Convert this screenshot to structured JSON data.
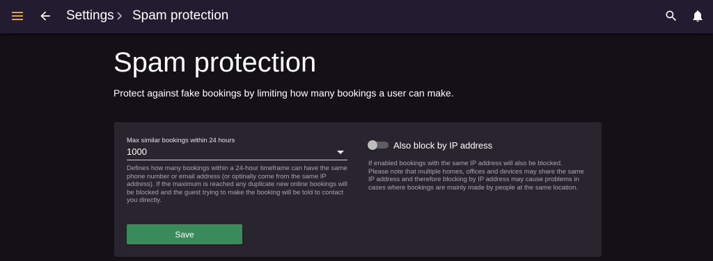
{
  "header": {
    "menu_icon": "hamburger-menu-icon",
    "back_icon": "arrow-left-icon",
    "breadcrumb": [
      "Settings",
      "Spam protection"
    ],
    "separator_icon": "chevron-right-icon",
    "search_icon": "search-icon",
    "bell_icon": "bell-icon",
    "accent_color": "#e2a33e"
  },
  "page": {
    "title": "Spam protection",
    "description": "Protect against fake bookings by limiting how many bookings a user can make."
  },
  "form": {
    "max_bookings": {
      "label": "Max similar bookings within 24 hours",
      "value": "1000",
      "helper": "Defines how many bookings within a 24-hour timeframe can have the same phone number or email address (or optinally come from the same IP address). If the maximum is reached any duplicate new online bookings will be blocked and the guest trying to make the booking will be told to contact you directly."
    },
    "block_ip": {
      "label": "Also block by IP address",
      "enabled": false,
      "helper": "If enabled bookings with the same IP address will also be blocked. Please note that multiple homes, offices and devices may share the same IP address and therefore blocking by IP address may cause problems in cases where bookings are mainly made by people at the same location."
    },
    "save_label": "Save",
    "save_color": "#3a8b5a"
  }
}
